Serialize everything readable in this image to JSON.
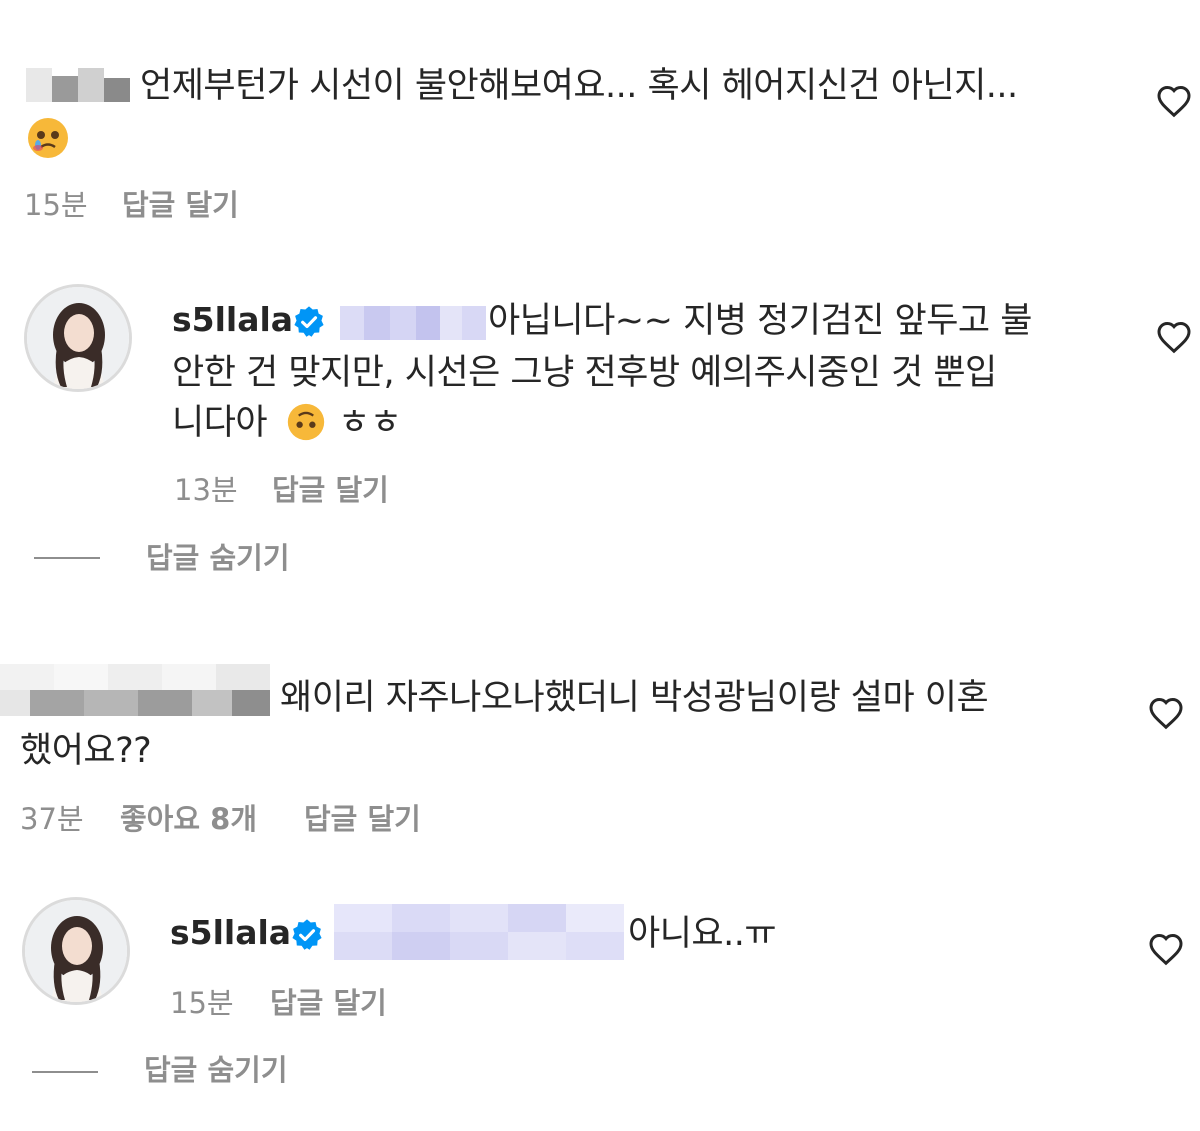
{
  "comments": [
    {
      "id": "c1",
      "line1": "언제부턴가 시선이 불안해보여요... 혹시 헤어지신건 아닌지...",
      "emoji": "crying-face-emoji",
      "time": "15분",
      "reply_label": "답글 달기"
    },
    {
      "id": "r1",
      "username": "s5llala",
      "line1": "아닙니다~~ 지병 정기검진 앞두고 불",
      "line2": "안한 건 맞지만, 시선은 그냥 전후방 예의주시중인 것 뿐입",
      "line3_pre": "니다아",
      "line3_post": "ㅎㅎ",
      "emoji": "upside-down-face-emoji",
      "time": "13분",
      "reply_label": "답글 달기",
      "hide_label": "답글 숨기기"
    },
    {
      "id": "c2",
      "line1": "왜이리 자주나오나했더니 박성광님이랑 설마 이혼",
      "line2": "했어요??",
      "time": "37분",
      "likes_label": "좋아요 8개",
      "reply_label": "답글 달기"
    },
    {
      "id": "r2",
      "username": "s5llala",
      "line1": "아니요..ㅠ",
      "time": "15분",
      "reply_label": "답글 달기",
      "hide_label": "답글 숨기기"
    }
  ],
  "icons": {
    "like": "heart-outline-icon",
    "verified": "verified-badge-icon"
  },
  "colors": {
    "text": "#262626",
    "secondary": "#8e8e8e",
    "verified_blue": "#0095f6"
  }
}
